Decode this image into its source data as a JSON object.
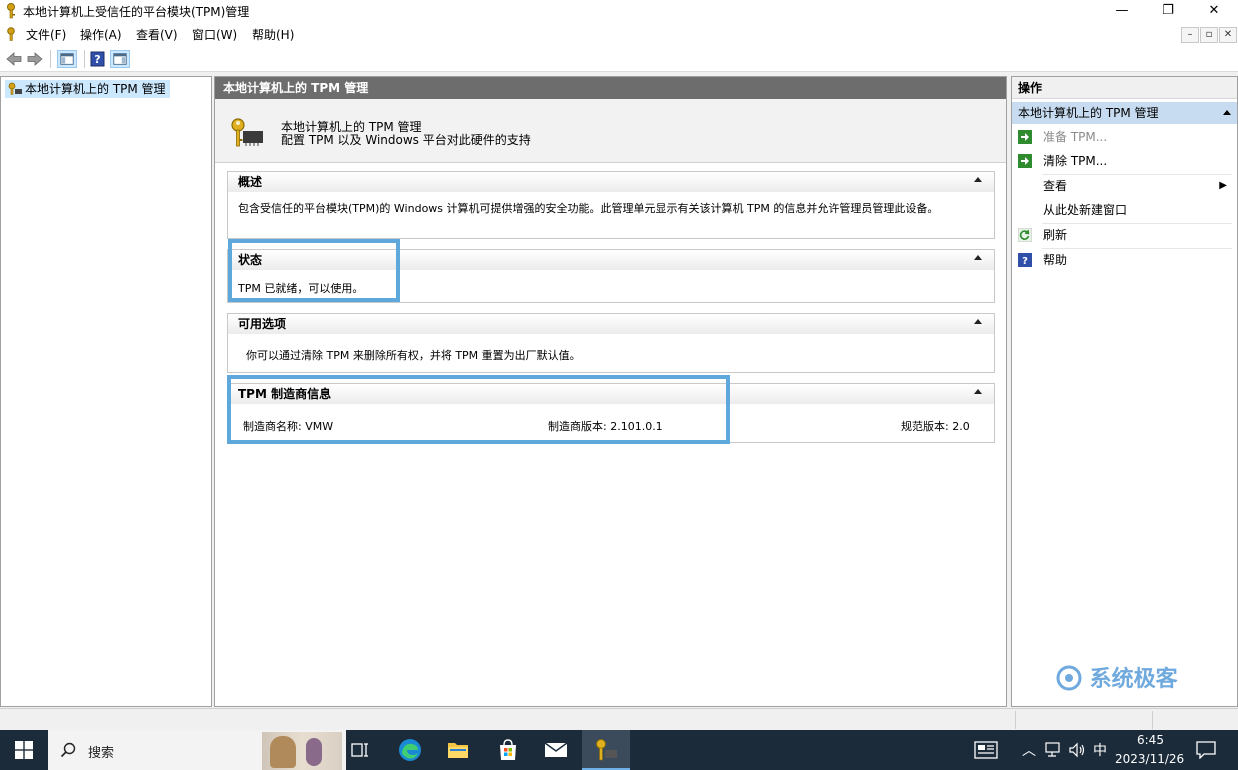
{
  "window": {
    "title": "本地计算机上受信任的平台模块(TPM)管理",
    "controls": {
      "minimize": "—",
      "restore": "❐",
      "close": "✕"
    }
  },
  "menubar": {
    "items": [
      "文件(F)",
      "操作(A)",
      "查看(V)",
      "窗口(W)",
      "帮助(H)"
    ]
  },
  "toolbar": {
    "buttons": [
      "back-icon",
      "forward-icon",
      "show-hide-console-tree-icon",
      "help-icon",
      "show-hide-action-pane-icon"
    ]
  },
  "tree": {
    "root_label": "本地计算机上的 TPM 管理"
  },
  "center": {
    "header": "本地计算机上的 TPM 管理",
    "intro_title": "本地计算机上的 TPM 管理",
    "intro_desc": "配置 TPM 以及 Windows 平台对此硬件的支持",
    "sections": {
      "overview": {
        "title": "概述",
        "body": "包含受信任的平台模块(TPM)的 Windows 计算机可提供增强的安全功能。此管理单元显示有关该计算机 TPM 的信息并允许管理员管理此设备。"
      },
      "status": {
        "title": "状态",
        "body": "TPM 已就绪，可以使用。"
      },
      "options": {
        "title": "可用选项",
        "body": "你可以通过清除 TPM 来删除所有权，并将 TPM 重置为出厂默认值。"
      },
      "manufacturer": {
        "title": "TPM 制造商信息",
        "name": "制造商名称: VMW",
        "version": "制造商版本: 2.101.0.1",
        "spec": "规范版本: 2.0"
      }
    }
  },
  "actions": {
    "header": "操作",
    "sub_header": "本地计算机上的 TPM 管理",
    "items": [
      {
        "label": "准备 TPM...",
        "enabled": false,
        "icon": "green-arrow-icon"
      },
      {
        "label": "清除 TPM...",
        "enabled": true,
        "icon": "green-arrow-icon"
      },
      {
        "label": "查看",
        "enabled": true,
        "submenu": true
      },
      {
        "label": "从此处新建窗口",
        "enabled": true
      },
      {
        "label": "刷新",
        "enabled": true,
        "icon": "refresh-icon"
      },
      {
        "label": "帮助",
        "enabled": true,
        "icon": "help-icon"
      }
    ]
  },
  "taskbar": {
    "search_label": "搜索",
    "ime": "中",
    "time": "6:45",
    "date": "2023/11/26"
  },
  "watermark": "系统极客",
  "colors": {
    "highlight_border": "#5fa8dc",
    "taskbar_bg": "#1b2b3a",
    "center_header_bg": "#6d6d6d",
    "tree_selection": "#cce8ff",
    "action_subheader": "#c7dcf0"
  }
}
